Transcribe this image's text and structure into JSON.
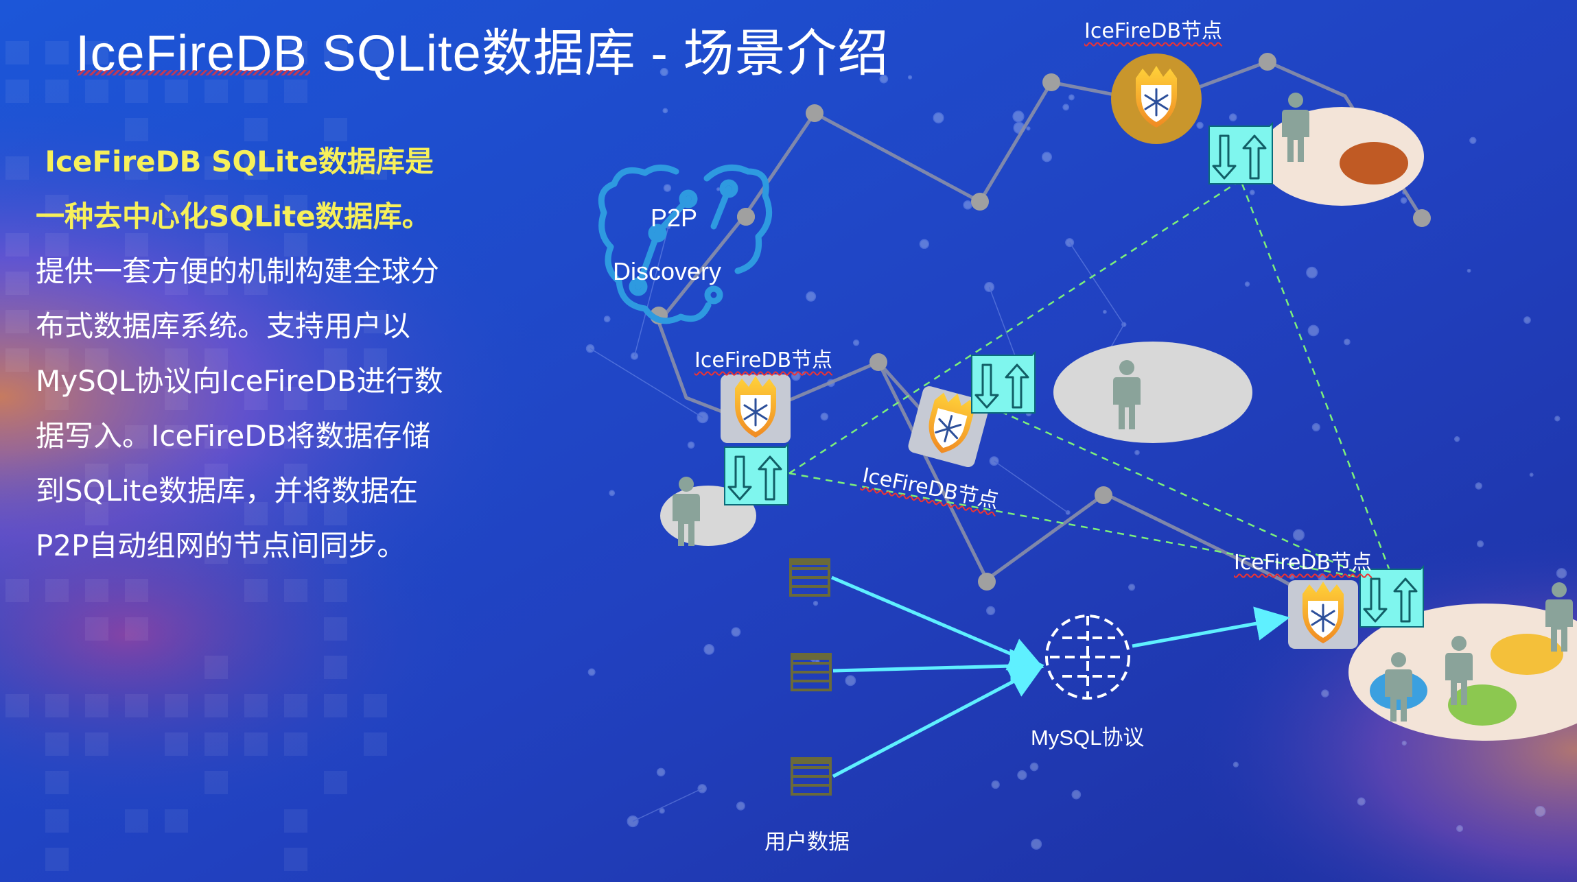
{
  "title": "IceFireDB SQLite数据库 - 场景介绍",
  "description": {
    "highlight": "IceFireDB SQLite数据库是一种去中心化SQLite数据库。",
    "body": "提供一套方便的机制构建全球分布式数据库系统。支持用户以MySQL协议向IceFireDB进行数据写入。IceFireDB将数据存储到SQLite数据库，并将数据在P2P自动组网的节点间同步。"
  },
  "diagram": {
    "p2p_line1": "P2P",
    "p2p_line2": "Discovery",
    "node_label_top": "IceFireDB节点",
    "node_label_left": "IceFireDB节点",
    "node_label_center": "IceFireDB节点",
    "node_label_right": "IceFireDB节点",
    "mysql_label": "MySQL协议",
    "user_data_label": "用户数据"
  },
  "colors": {
    "background": "#1f4fc8",
    "highlight_text": "#f7f05a",
    "sync_box": "#7ff6ee",
    "arrow": "#5ff0ff",
    "dashed_link": "#7df07a",
    "network_dot": "#9a9a9a",
    "person": "#8aa39a"
  }
}
